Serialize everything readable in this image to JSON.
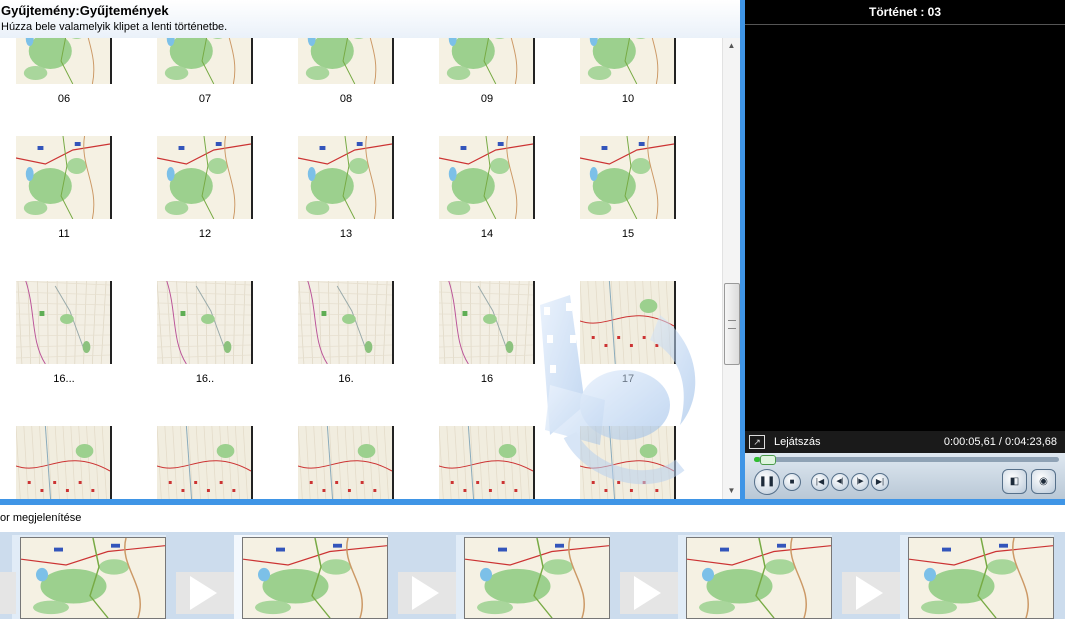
{
  "collection": {
    "title": "Gyűjtemény:Gyűjtemények",
    "subtitle": "Húzza bele valamelyik klipet a lenti történetbe.",
    "rows": [
      {
        "labels": [
          "06",
          "07",
          "08",
          "09",
          "10"
        ]
      },
      {
        "labels": [
          "11",
          "12",
          "13",
          "14",
          "15"
        ]
      },
      {
        "labels": [
          "16...",
          "16..",
          "16.",
          "16",
          "17"
        ]
      },
      {
        "labels": [
          "",
          "",
          "",
          "",
          ""
        ]
      }
    ]
  },
  "player": {
    "title": "Történet : 03",
    "status": "Lejátszás",
    "time": "0:00:05,61 / 0:04:23,68",
    "progress": 0.021
  },
  "storyboard": {
    "label": "or megjelenítése"
  },
  "icons": {
    "scroll_up": "arrow-up-icon",
    "scroll_down": "arrow-down-icon",
    "pause": "pause-icon",
    "stop": "stop-icon",
    "previous": "skip-previous-icon",
    "rewind": "rewind-icon",
    "forward": "fast-forward-icon",
    "next": "skip-next-icon",
    "split": "split-clip-icon",
    "snapshot": "camera-icon",
    "fullscreen": "fullscreen-icon"
  },
  "colors": {
    "accent": "#3f95e6",
    "player_bg": "#000000",
    "progress": "#2fbf2f"
  }
}
